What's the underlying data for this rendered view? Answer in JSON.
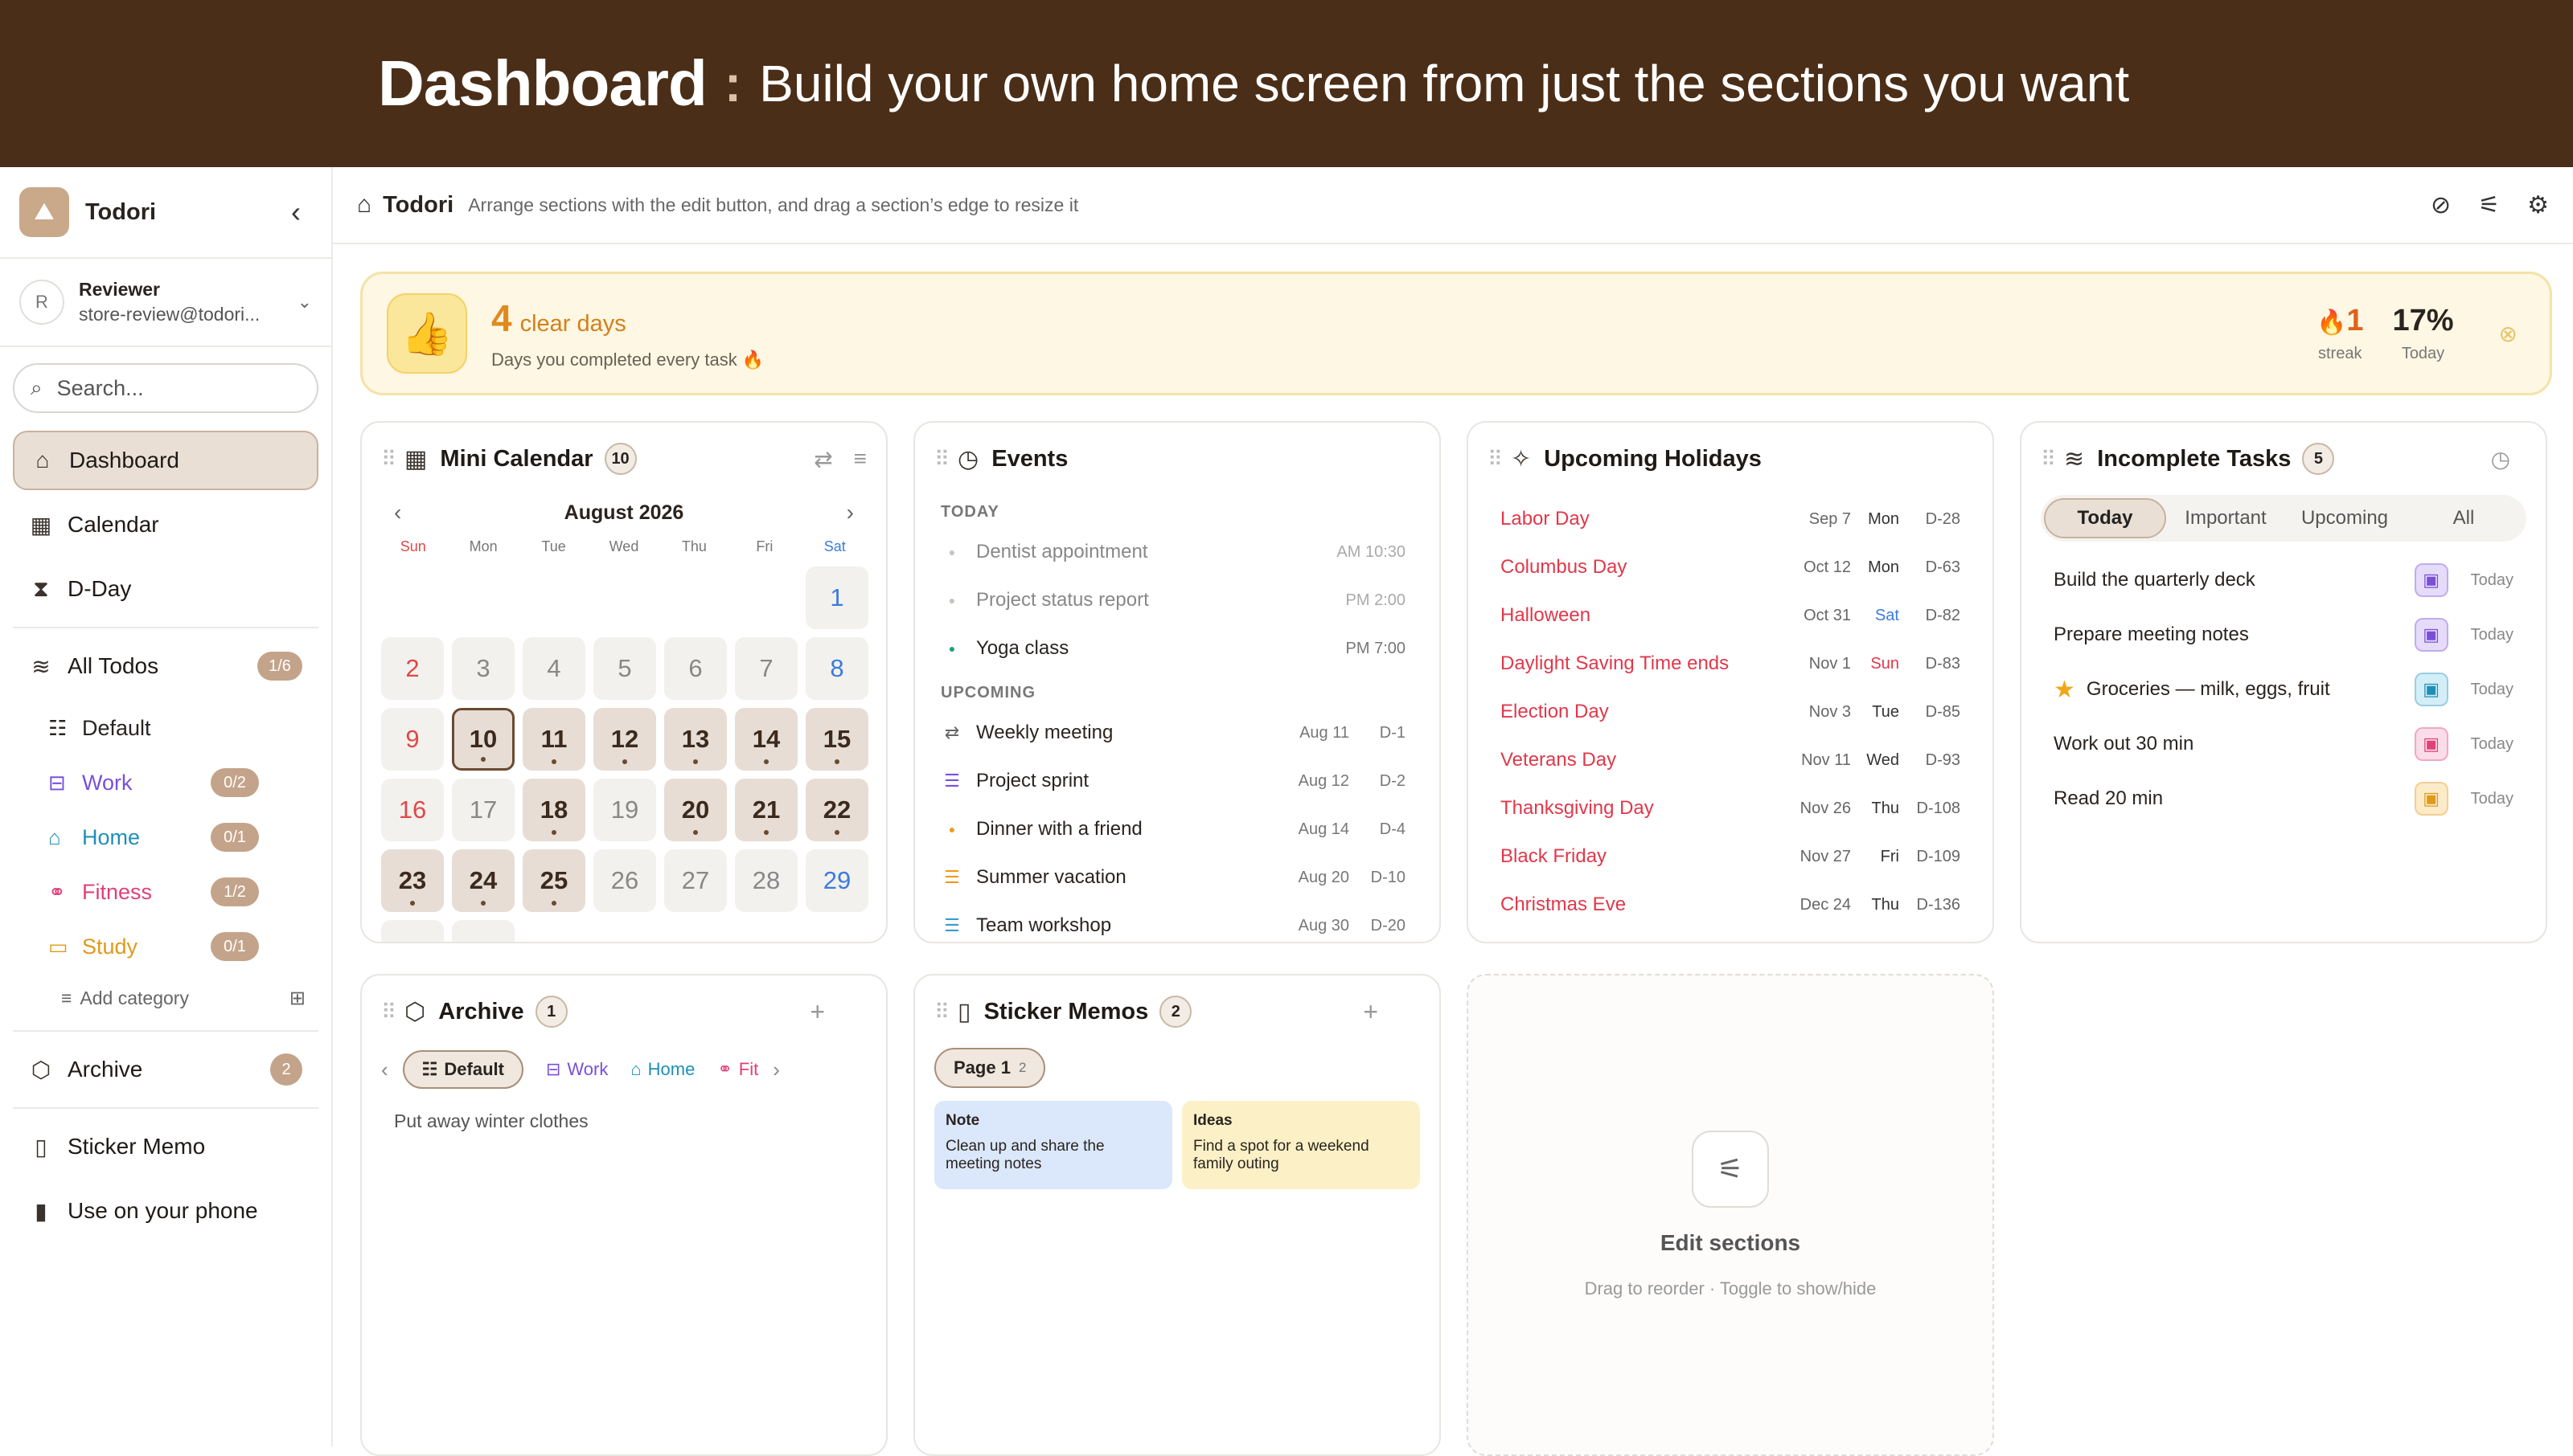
{
  "banner": {
    "title": "Dashboard",
    "sep": ":",
    "subtitle": "Build your own home screen from just the sections you want"
  },
  "sidebar": {
    "app_name": "Todori",
    "collapse": "‹",
    "account": {
      "initial": "R",
      "name": "Reviewer",
      "email": "store-review@todori..."
    },
    "search_placeholder": "Search...",
    "nav": [
      {
        "label": "Dashboard",
        "icon": "home-icon"
      },
      {
        "label": "Calendar",
        "icon": "calendar-icon"
      },
      {
        "label": "D-Day",
        "icon": "hourglass-icon"
      }
    ],
    "all_todos": {
      "label": "All Todos",
      "count": "1/6"
    },
    "categories": [
      {
        "label": "Default",
        "count": "",
        "color": "#2a2420"
      },
      {
        "label": "Work",
        "count": "0/2",
        "color": "#7a4fd8"
      },
      {
        "label": "Home",
        "count": "0/1",
        "color": "#1f8fb8"
      },
      {
        "label": "Fitness",
        "count": "1/2",
        "color": "#e0407a"
      },
      {
        "label": "Study",
        "count": "0/1",
        "color": "#e09a1a"
      }
    ],
    "add_category": "Add category",
    "archive": {
      "label": "Archive",
      "count": "2"
    },
    "sticker_memo": "Sticker Memo",
    "use_phone": "Use on your phone"
  },
  "header": {
    "title": "Todori",
    "hint": "Arrange sections with the edit button, and drag a section’s edge to resize it"
  },
  "streak": {
    "value": "4",
    "unit": "clear days",
    "subtitle": "Days you completed every task 🔥",
    "streak_value": "1",
    "streak_label": "streak",
    "today_value": "17%",
    "today_label": "Today"
  },
  "calendar": {
    "title": "Mini Calendar",
    "badge": "10",
    "month": "August 2026",
    "dow": [
      "Sun",
      "Mon",
      "Tue",
      "Wed",
      "Thu",
      "Fri",
      "Sat"
    ]
  },
  "events": {
    "title": "Events",
    "today_label": "TODAY",
    "upcoming_label": "UPCOMING",
    "today": [
      {
        "name": "Dentist appointment",
        "time": "AM 10:30",
        "color": "#c9c3bd"
      },
      {
        "name": "Project status report",
        "time": "PM 2:00",
        "color": "#c9c3bd"
      },
      {
        "name": "Yoga class",
        "time": "PM 7:00",
        "color": "#1aa37a"
      }
    ],
    "upcoming": [
      {
        "name": "Weekly meeting",
        "date": "Aug 11",
        "dday": "D-1",
        "icon": "⇄",
        "color": "#666"
      },
      {
        "name": "Project sprint",
        "date": "Aug 12",
        "dday": "D-2",
        "icon": "☰",
        "color": "#7a4fd8"
      },
      {
        "name": "Dinner with a friend",
        "date": "Aug 14",
        "dday": "D-4",
        "icon": "●",
        "color": "#f09a1a"
      },
      {
        "name": "Summer vacation",
        "date": "Aug 20",
        "dday": "D-10",
        "icon": "☰",
        "color": "#f09a1a"
      },
      {
        "name": "Team workshop",
        "date": "Aug 30",
        "dday": "D-20",
        "icon": "☰",
        "color": "#3b9bd0"
      }
    ]
  },
  "holidays": {
    "title": "Upcoming Holidays",
    "items": [
      {
        "name": "Labor Day",
        "date": "Sep 7",
        "dow": "Mon",
        "dday": "D-28"
      },
      {
        "name": "Columbus Day",
        "date": "Oct 12",
        "dow": "Mon",
        "dday": "D-63"
      },
      {
        "name": "Halloween",
        "date": "Oct 31",
        "dow": "Sat",
        "dday": "D-82"
      },
      {
        "name": "Daylight Saving Time ends",
        "date": "Nov 1",
        "dow": "Sun",
        "dday": "D-83"
      },
      {
        "name": "Election Day",
        "date": "Nov 3",
        "dow": "Tue",
        "dday": "D-85"
      },
      {
        "name": "Veterans Day",
        "date": "Nov 11",
        "dow": "Wed",
        "dday": "D-93"
      },
      {
        "name": "Thanksgiving Day",
        "date": "Nov 26",
        "dow": "Thu",
        "dday": "D-108"
      },
      {
        "name": "Black Friday",
        "date": "Nov 27",
        "dow": "Fri",
        "dday": "D-109"
      },
      {
        "name": "Christmas Eve",
        "date": "Dec 24",
        "dow": "Thu",
        "dday": "D-136"
      }
    ]
  },
  "tasks": {
    "title": "Incomplete Tasks",
    "badge": "5",
    "tabs": [
      "Today",
      "Important",
      "Upcoming",
      "All"
    ],
    "items": [
      {
        "name": "Build the quarterly deck",
        "when": "Today",
        "bg": "#e6dcfa",
        "fg": "#7a4fd8",
        "star": false
      },
      {
        "name": "Prepare meeting notes",
        "when": "Today",
        "bg": "#e6dcfa",
        "fg": "#7a4fd8",
        "star": false
      },
      {
        "name": "Groceries — milk, eggs, fruit",
        "when": "Today",
        "bg": "#d4eef7",
        "fg": "#1f8fb8",
        "star": true
      },
      {
        "name": "Work out 30 min",
        "when": "Today",
        "bg": "#fbdde9",
        "fg": "#e0407a",
        "star": false
      },
      {
        "name": "Read 20 min",
        "when": "Today",
        "bg": "#fcebc9",
        "fg": "#e09a1a",
        "star": false
      }
    ]
  },
  "archive": {
    "title": "Archive",
    "badge": "1",
    "chips": [
      "Default",
      "Work",
      "Home",
      "Fit"
    ],
    "item": "Put away winter clothes"
  },
  "memos": {
    "title": "Sticker Memos",
    "badge": "2",
    "page": "Page 1",
    "page_count": "2",
    "items": [
      {
        "title": "Note",
        "body": "Clean up and share the meeting notes",
        "bg": "#dbe8fb"
      },
      {
        "title": "Ideas",
        "body": "Find a spot for a weekend family outing",
        "bg": "#fcf1c6"
      }
    ]
  },
  "edit": {
    "title": "Edit sections",
    "subtitle": "Drag to reorder · Toggle to show/hide"
  }
}
